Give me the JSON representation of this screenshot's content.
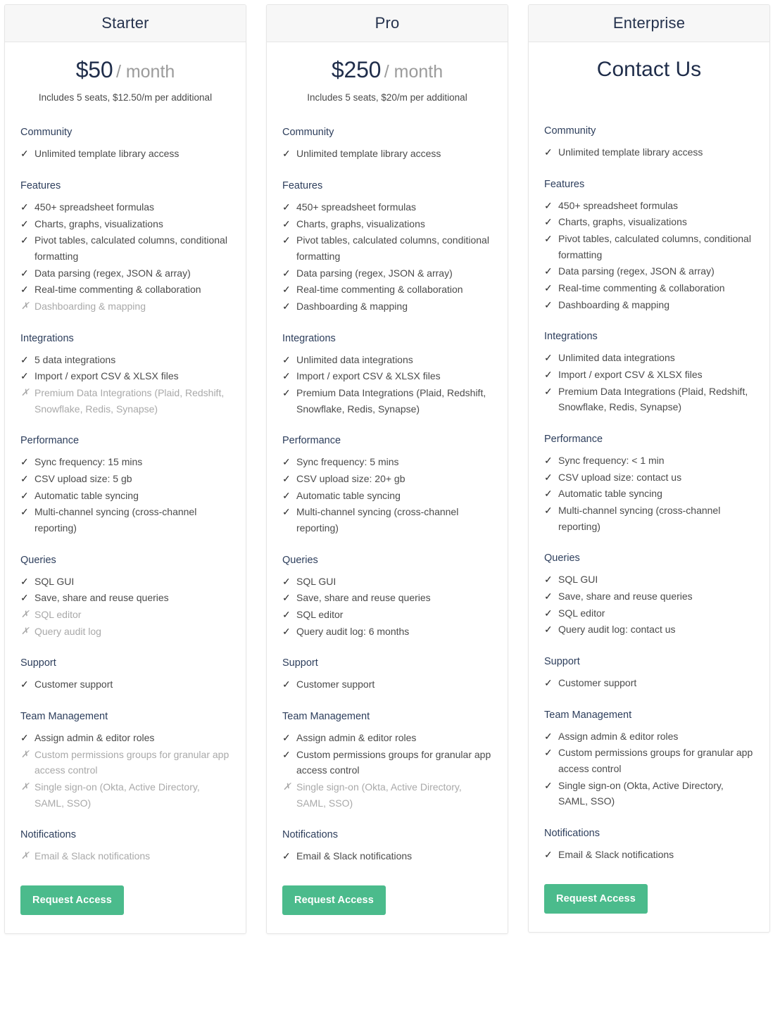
{
  "marks": {
    "included": "✓",
    "excluded": "✗"
  },
  "colors": {
    "accent_green": "#4bbb8c",
    "heading_navy": "#2d3e5c",
    "price_navy": "#1f2d4a",
    "muted_gray": "#a9a9a9"
  },
  "cta_label": "Request Access",
  "plans": [
    {
      "name": "Starter",
      "price_amount": "$50",
      "price_period": "/ month",
      "price_contact": "",
      "price_note": "Includes 5 seats, $12.50/m per additional",
      "sections": [
        {
          "title": "Community",
          "items": [
            {
              "included": true,
              "text": "Unlimited template library access"
            }
          ]
        },
        {
          "title": "Features",
          "items": [
            {
              "included": true,
              "text": "450+ spreadsheet formulas"
            },
            {
              "included": true,
              "text": "Charts, graphs, visualizations"
            },
            {
              "included": true,
              "text": "Pivot tables, calculated columns, conditional formatting"
            },
            {
              "included": true,
              "text": "Data parsing (regex, JSON & array)"
            },
            {
              "included": true,
              "text": "Real-time commenting & collaboration"
            },
            {
              "included": false,
              "text": "Dashboarding & mapping"
            }
          ]
        },
        {
          "title": "Integrations",
          "items": [
            {
              "included": true,
              "text": "5 data integrations"
            },
            {
              "included": true,
              "text": "Import / export CSV & XLSX files"
            },
            {
              "included": false,
              "text": "Premium Data Integrations (Plaid, Redshift, Snowflake, Redis, Synapse)"
            }
          ]
        },
        {
          "title": "Performance",
          "items": [
            {
              "included": true,
              "text": "Sync frequency: 15 mins"
            },
            {
              "included": true,
              "text": "CSV upload size: 5 gb"
            },
            {
              "included": true,
              "text": "Automatic table syncing"
            },
            {
              "included": true,
              "text": "Multi-channel syncing (cross-channel reporting)"
            }
          ]
        },
        {
          "title": "Queries",
          "items": [
            {
              "included": true,
              "text": "SQL GUI"
            },
            {
              "included": true,
              "text": "Save, share and reuse queries"
            },
            {
              "included": false,
              "text": "SQL editor"
            },
            {
              "included": false,
              "text": "Query audit log"
            }
          ]
        },
        {
          "title": "Support",
          "items": [
            {
              "included": true,
              "text": "Customer support"
            }
          ]
        },
        {
          "title": "Team Management",
          "items": [
            {
              "included": true,
              "text": "Assign admin & editor roles"
            },
            {
              "included": false,
              "text": "Custom permissions groups for granular app access control"
            },
            {
              "included": false,
              "text": "Single sign-on (Okta, Active Directory, SAML, SSO)"
            }
          ]
        },
        {
          "title": "Notifications",
          "items": [
            {
              "included": false,
              "text": "Email & Slack notifications"
            }
          ]
        }
      ]
    },
    {
      "name": "Pro",
      "price_amount": "$250",
      "price_period": "/ month",
      "price_contact": "",
      "price_note": "Includes 5 seats, $20/m per additional",
      "sections": [
        {
          "title": "Community",
          "items": [
            {
              "included": true,
              "text": "Unlimited template library access"
            }
          ]
        },
        {
          "title": "Features",
          "items": [
            {
              "included": true,
              "text": "450+ spreadsheet formulas"
            },
            {
              "included": true,
              "text": "Charts, graphs, visualizations"
            },
            {
              "included": true,
              "text": "Pivot tables, calculated columns, conditional formatting"
            },
            {
              "included": true,
              "text": "Data parsing (regex, JSON & array)"
            },
            {
              "included": true,
              "text": "Real-time commenting & collaboration"
            },
            {
              "included": true,
              "text": "Dashboarding & mapping"
            }
          ]
        },
        {
          "title": "Integrations",
          "items": [
            {
              "included": true,
              "text": "Unlimited data integrations"
            },
            {
              "included": true,
              "text": "Import / export CSV & XLSX files"
            },
            {
              "included": true,
              "text": "Premium Data Integrations (Plaid, Redshift, Snowflake, Redis, Synapse)"
            }
          ]
        },
        {
          "title": "Performance",
          "items": [
            {
              "included": true,
              "text": "Sync frequency: 5 mins"
            },
            {
              "included": true,
              "text": "CSV upload size: 20+ gb"
            },
            {
              "included": true,
              "text": "Automatic table syncing"
            },
            {
              "included": true,
              "text": "Multi-channel syncing (cross-channel reporting)"
            }
          ]
        },
        {
          "title": "Queries",
          "items": [
            {
              "included": true,
              "text": "SQL GUI"
            },
            {
              "included": true,
              "text": "Save, share and reuse queries"
            },
            {
              "included": true,
              "text": "SQL editor"
            },
            {
              "included": true,
              "text": "Query audit log: 6 months"
            }
          ]
        },
        {
          "title": "Support",
          "items": [
            {
              "included": true,
              "text": "Customer support"
            }
          ]
        },
        {
          "title": "Team Management",
          "items": [
            {
              "included": true,
              "text": "Assign admin & editor roles"
            },
            {
              "included": true,
              "text": "Custom permissions groups for granular app access control"
            },
            {
              "included": false,
              "text": "Single sign-on (Okta, Active Directory, SAML, SSO)"
            }
          ]
        },
        {
          "title": "Notifications",
          "items": [
            {
              "included": true,
              "text": "Email & Slack notifications"
            }
          ]
        }
      ]
    },
    {
      "name": "Enterprise",
      "price_amount": "",
      "price_period": "",
      "price_contact": "Contact Us",
      "price_note": "",
      "sections": [
        {
          "title": "Community",
          "items": [
            {
              "included": true,
              "text": "Unlimited template library access"
            }
          ]
        },
        {
          "title": "Features",
          "items": [
            {
              "included": true,
              "text": "450+ spreadsheet formulas"
            },
            {
              "included": true,
              "text": "Charts, graphs, visualizations"
            },
            {
              "included": true,
              "text": "Pivot tables, calculated columns, conditional formatting"
            },
            {
              "included": true,
              "text": "Data parsing (regex, JSON & array)"
            },
            {
              "included": true,
              "text": "Real-time commenting & collaboration"
            },
            {
              "included": true,
              "text": "Dashboarding & mapping"
            }
          ]
        },
        {
          "title": "Integrations",
          "items": [
            {
              "included": true,
              "text": "Unlimited data integrations"
            },
            {
              "included": true,
              "text": "Import / export CSV & XLSX files"
            },
            {
              "included": true,
              "text": "Premium Data Integrations (Plaid, Redshift, Snowflake, Redis, Synapse)"
            }
          ]
        },
        {
          "title": "Performance",
          "items": [
            {
              "included": true,
              "text": "Sync frequency: < 1 min"
            },
            {
              "included": true,
              "text": "CSV upload size: contact us"
            },
            {
              "included": true,
              "text": "Automatic table syncing"
            },
            {
              "included": true,
              "text": "Multi-channel syncing (cross-channel reporting)"
            }
          ]
        },
        {
          "title": "Queries",
          "items": [
            {
              "included": true,
              "text": "SQL GUI"
            },
            {
              "included": true,
              "text": "Save, share and reuse queries"
            },
            {
              "included": true,
              "text": "SQL editor"
            },
            {
              "included": true,
              "text": "Query audit log: contact us"
            }
          ]
        },
        {
          "title": "Support",
          "items": [
            {
              "included": true,
              "text": "Customer support"
            }
          ]
        },
        {
          "title": "Team Management",
          "items": [
            {
              "included": true,
              "text": "Assign admin & editor roles"
            },
            {
              "included": true,
              "text": "Custom permissions groups for granular app access control"
            },
            {
              "included": true,
              "text": "Single sign-on (Okta, Active Directory, SAML, SSO)"
            }
          ]
        },
        {
          "title": "Notifications",
          "items": [
            {
              "included": true,
              "text": "Email & Slack notifications"
            }
          ]
        }
      ]
    }
  ]
}
